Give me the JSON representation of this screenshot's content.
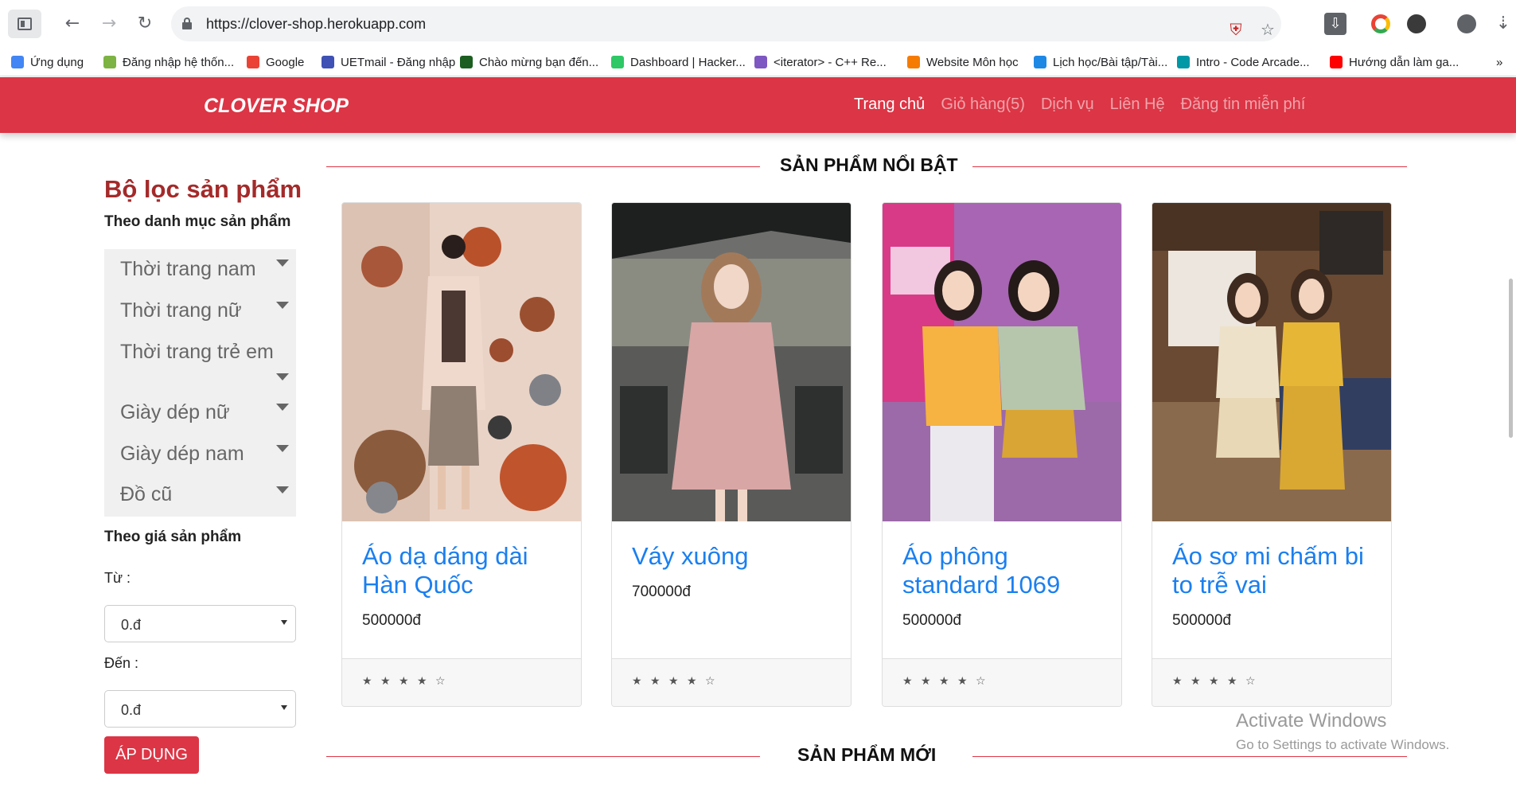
{
  "browser": {
    "url": "https://clover-shop.herokuapp.com",
    "bookmarks": [
      {
        "label": "Ứng dụng",
        "color": "#4285f4"
      },
      {
        "label": "Đăng nhập hệ thốn...",
        "color": "#7cb342"
      },
      {
        "label": "Google",
        "color": "#ea4335"
      },
      {
        "label": "UETmail - Đăng nhập",
        "color": "#3f51b5"
      },
      {
        "label": "Chào mừng bạn đến...",
        "color": "#1b5e20"
      },
      {
        "label": "Dashboard | Hacker...",
        "color": "#2ec866"
      },
      {
        "label": "<iterator> - C++ Re...",
        "color": "#7e57c2"
      },
      {
        "label": "Website Môn học",
        "color": "#f57c00"
      },
      {
        "label": "Lịch học/Bài tập/Tài...",
        "color": "#1e88e5"
      },
      {
        "label": "Intro - Code Arcade...",
        "color": "#0097a7"
      },
      {
        "label": "Hướng dẫn làm ga...",
        "color": "#ff0000"
      }
    ],
    "more_label": "»"
  },
  "header": {
    "brand": "CLOVER SHOP",
    "nav": [
      "Trang chủ",
      "Giỏ hàng(5)",
      "Dịch vụ",
      "Liên Hệ",
      "Đăng tin miễn phí"
    ],
    "active_index": 0,
    "color": "#dc3545"
  },
  "sidebar": {
    "title": "Bộ lọc sản phẩm",
    "category_heading": "Theo danh mục sản phẩm",
    "categories": [
      "Thời trang nam",
      "Thời trang nữ",
      "Thời trang trẻ em",
      "Giày dép nữ",
      "Giày dép nam",
      "Đồ cũ"
    ],
    "price_heading": "Theo giá sản phẩm",
    "from_label": "Từ :",
    "from_value": "0.đ",
    "to_label": "Đến :",
    "to_value": "0.đ",
    "apply_label": "ÁP DỤNG"
  },
  "featured": {
    "title": "SẢN PHẨM NỔI BẬT",
    "products": [
      {
        "name": "Áo dạ dáng dài Hàn Quốc",
        "price": "500000đ",
        "rating": "★ ★ ★ ★ ☆"
      },
      {
        "name": "Váy xuông",
        "price": "700000đ",
        "rating": "★ ★ ★ ★ ☆"
      },
      {
        "name": "Áo phông standard 1069",
        "price": "500000đ",
        "rating": "★ ★ ★ ★ ☆"
      },
      {
        "name": "Áo sơ mi chấm bi to trễ vai",
        "price": "500000đ",
        "rating": "★ ★ ★ ★ ☆"
      }
    ]
  },
  "new_section": {
    "title": "SẢN PHẨM MỚI"
  },
  "watermark": {
    "line1": "Activate Windows",
    "line2": "Go to Settings to activate Windows."
  }
}
